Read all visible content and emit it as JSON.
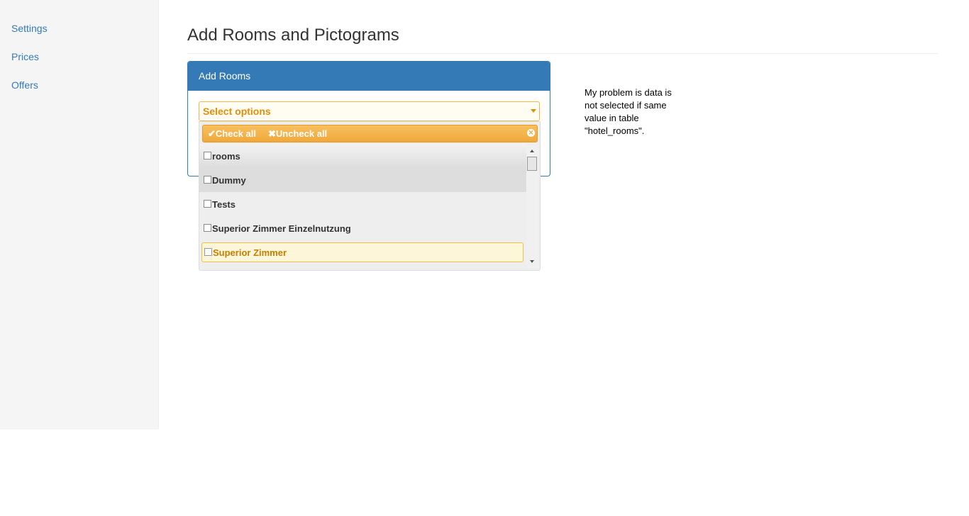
{
  "sidebar": {
    "items": [
      {
        "label": "Settings"
      },
      {
        "label": "Prices"
      },
      {
        "label": "Offers"
      }
    ]
  },
  "page": {
    "title": "Add Rooms and Pictograms"
  },
  "panel": {
    "heading": "Add Rooms"
  },
  "multiselect": {
    "placeholder": "Select options",
    "check_all_label": "Check all",
    "uncheck_all_label": "Uncheck all",
    "options": [
      {
        "label": "rooms",
        "checked": false
      },
      {
        "label": "Dummy",
        "checked": false
      },
      {
        "label": "Tests",
        "checked": false
      },
      {
        "label": "Superior Zimmer Einzelnutzung",
        "checked": false
      },
      {
        "label": "Superior Zimmer",
        "checked": false,
        "highlighted": true
      }
    ]
  },
  "note": {
    "lines": [
      "My problem is data is",
      "not selected if same",
      "value in table",
      "\"hotel_rooms\"."
    ]
  },
  "colors": {
    "primary": "#337ab7",
    "accent_orange": "#f0a83a",
    "highlight_text": "#c77c02"
  }
}
